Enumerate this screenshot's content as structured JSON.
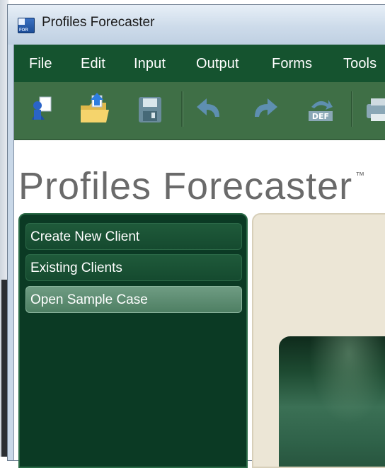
{
  "window": {
    "title": "Profiles Forecaster",
    "icon": "app-icon",
    "icon_text": "FOR"
  },
  "menu": [
    "File",
    "Edit",
    "Input",
    "Output",
    "Forms",
    "Tools"
  ],
  "toolbar": {
    "icons": [
      "new-client-icon",
      "open-folder-icon",
      "save-icon",
      "undo-icon",
      "redo-icon",
      "default-icon",
      "print-icon"
    ],
    "default_badge": "DEF"
  },
  "brand": {
    "name": "Profiles Forecaster",
    "trademark": "™"
  },
  "nav": {
    "items": [
      "Create New Client",
      "Existing Clients",
      "Open Sample Case"
    ],
    "active_index": 2
  },
  "colors": {
    "menu_bg": "#15532f",
    "toolbar_bg": "#3f6f46",
    "nav_bg": "#0b3a24",
    "pane_bg": "#ece6d6"
  }
}
